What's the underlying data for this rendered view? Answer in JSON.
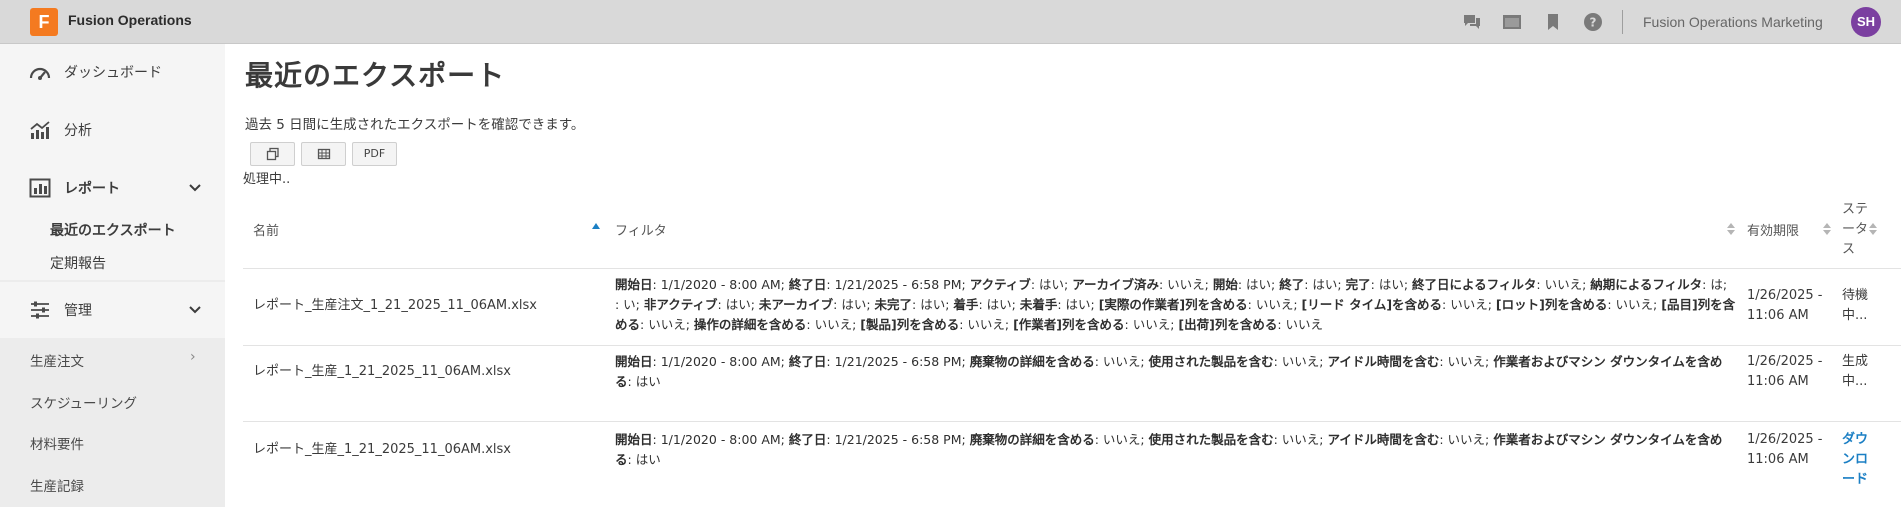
{
  "app": {
    "logo_letter": "F",
    "title": "Fusion Operations",
    "org_name": "Fusion Operations Marketing",
    "user_initials": "SH",
    "accent": "#f47a20",
    "avatar_color": "#7b3fa0"
  },
  "topbar_icons": [
    "chat-icon",
    "window-icon",
    "bookmark-icon",
    "help-icon"
  ],
  "sidebar": {
    "dashboard": "ダッシュボード",
    "analytics": "分析",
    "reports": "レポート",
    "reports_sub": {
      "recent_exports": "最近のエクスポート",
      "scheduled": "定期報告"
    },
    "admin": "管理",
    "items": [
      "生産注文",
      "スケジューリング",
      "材料要件",
      "生産記録"
    ]
  },
  "main": {
    "title": "最近のエクスポート",
    "subtitle": "過去 5 日間に生成されたエクスポートを確認できます。",
    "toolbar": {
      "pdf": "PDF"
    },
    "processing": "処理中..",
    "columns": {
      "name": "名前",
      "filter": "フィルタ",
      "expiry": "有効期限",
      "status": "ステータス"
    }
  },
  "rows": [
    {
      "name": "レポート_生産注文_1_21_2025_11_06AM.xlsx",
      "filters": [
        [
          "開始日",
          "1/1/2020 - 8:00 AM"
        ],
        [
          "終了日",
          "1/21/2025 - 6:58 PM"
        ],
        [
          "アクティブ",
          "はい"
        ],
        [
          "アーカイブ済み",
          "いいえ"
        ],
        [
          "開始",
          "はい"
        ],
        [
          "終了",
          "はい"
        ],
        [
          "完了",
          "はい"
        ],
        [
          "終了日によるフィルタ",
          "いいえ"
        ],
        [
          "納期によるフィルタ",
          "はい"
        ],
        [
          "非アクティブ",
          "はい"
        ],
        [
          "未アーカイブ",
          "はい"
        ],
        [
          "未完了",
          "はい"
        ],
        [
          "着手",
          "はい"
        ],
        [
          "未着手",
          "はい"
        ],
        [
          "[実際の作業者]列を含める",
          "いいえ"
        ],
        [
          "[リード タイム]を含める",
          "いいえ"
        ],
        [
          "[ロット]列を含める",
          "いいえ"
        ],
        [
          "[品目]列を含める",
          "いいえ"
        ],
        [
          "操作の詳細を含める",
          "いいえ"
        ],
        [
          "[製品]列を含める",
          "いいえ"
        ],
        [
          "[作業者]列を含める",
          "いいえ"
        ],
        [
          "[出荷]列を含める",
          "いいえ"
        ]
      ],
      "filter_lines": [
        [
          [
            "開始日",
            "1/1/2020 - 8:00 AM"
          ],
          [
            "終了日",
            "1/21/2025 - 6:58 PM"
          ],
          [
            "アクティブ",
            "はい"
          ],
          [
            "アーカイブ済み",
            "いいえ"
          ],
          [
            "開始",
            "はい"
          ],
          [
            "終了",
            "はい"
          ],
          [
            "完了",
            "はい"
          ],
          [
            "終了日によるフィルタ",
            "いいえ"
          ],
          [
            "納期によるフィルタ",
            "は"
          ]
        ],
        [
          [
            "",
            "い"
          ],
          [
            "非アクティブ",
            "はい"
          ],
          [
            "未アーカイブ",
            "はい"
          ],
          [
            "未完了",
            "はい"
          ],
          [
            "着手",
            "はい"
          ],
          [
            "未着手",
            "はい"
          ],
          [
            "[実際の作業者]列を含める",
            "いいえ"
          ],
          [
            "[リード タイム]を含める",
            "いいえ"
          ],
          [
            "[ロット]列を含める",
            "いいえ"
          ],
          [
            "[品目]列を含"
          ]
        ],
        [
          [
            "める",
            "いいえ"
          ],
          [
            "操作の詳細を含める",
            "いいえ"
          ],
          [
            "[製品]列を含める",
            "いいえ"
          ],
          [
            "[作業者]列を含める",
            "いいえ"
          ],
          [
            "[出荷]列を含める",
            "いいえ"
          ]
        ]
      ],
      "expiry": [
        "1/26/2025 -",
        "11:06 AM"
      ],
      "status": [
        "待機",
        "中..."
      ]
    },
    {
      "name": "レポート_生産_1_21_2025_11_06AM.xlsx",
      "filter_lines": [
        [
          [
            "開始日",
            "1/1/2020 - 8:00 AM"
          ],
          [
            "終了日",
            "1/21/2025 - 6:58 PM"
          ],
          [
            "廃棄物の詳細を含める",
            "いいえ"
          ],
          [
            "使用された製品を含む",
            "いいえ"
          ],
          [
            "アイドル時間を含む",
            "いいえ"
          ],
          [
            "作業者およびマシン ダウンタイムを含め"
          ]
        ],
        [
          [
            "る",
            "はい"
          ]
        ]
      ],
      "expiry": [
        "1/26/2025 -",
        "11:06 AM"
      ],
      "status": [
        "生成",
        "中..."
      ]
    },
    {
      "name": "レポート_生産_1_21_2025_11_06AM.xlsx",
      "filter_lines": [
        [
          [
            "開始日",
            "1/1/2020 - 8:00 AM"
          ],
          [
            "終了日",
            "1/21/2025 - 6:58 PM"
          ],
          [
            "廃棄物の詳細を含める",
            "いいえ"
          ],
          [
            "使用された製品を含む",
            "いいえ"
          ],
          [
            "アイドル時間を含む",
            "いいえ"
          ],
          [
            "作業者およびマシン ダウンタイムを含め"
          ]
        ],
        [
          [
            "る",
            "はい"
          ]
        ]
      ],
      "expiry": [
        "1/26/2025 -",
        "11:06 AM"
      ],
      "status": [
        "ダウ",
        "ンロ",
        "ード"
      ]
    }
  ]
}
